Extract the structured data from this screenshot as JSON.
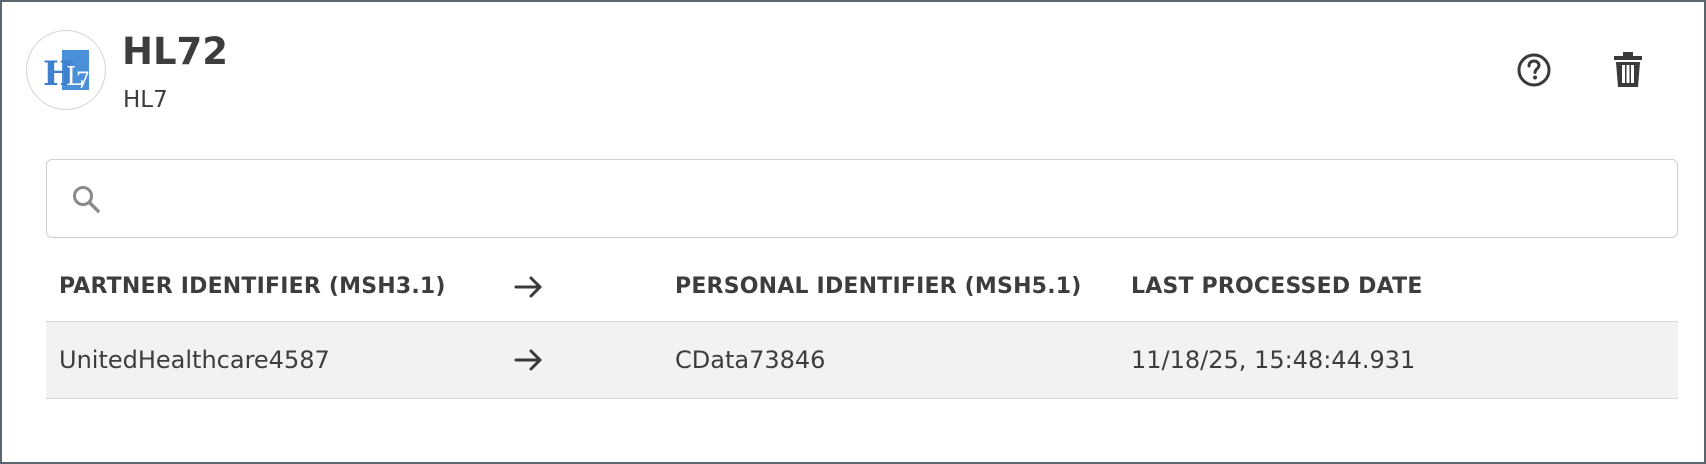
{
  "header": {
    "title": "HL72",
    "subtitle": "HL7",
    "logo_icon": "hl7-logo-icon",
    "logo_text": "HL7",
    "help_icon": "help-circle-icon",
    "delete_icon": "trash-icon"
  },
  "search": {
    "icon": "search-icon",
    "placeholder": "",
    "value": ""
  },
  "table": {
    "columns": [
      "PARTNER IDENTIFIER (MSH3.1)",
      "→",
      "PERSONAL IDENTIFIER (MSH5.1)",
      "LAST PROCESSED DATE"
    ],
    "rows": [
      {
        "partner_identifier": "UnitedHealthcare4587",
        "arrow": "→",
        "personal_identifier": "CData73846",
        "last_processed_date": "11/18/25, 15:48:44.931"
      }
    ]
  },
  "colors": {
    "border": "#5a6570",
    "text": "#3d3d3d",
    "row_background": "#f2f2f2",
    "logo_blue": "#4a90d9"
  }
}
